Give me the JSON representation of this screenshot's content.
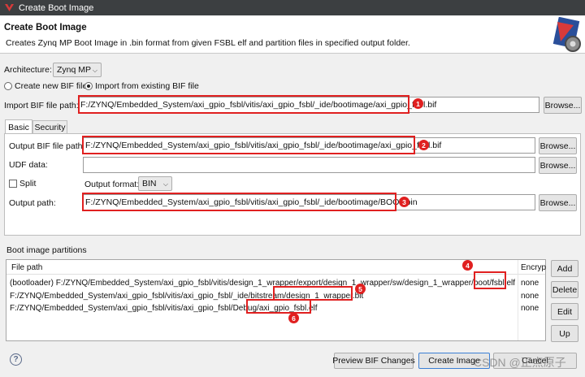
{
  "window": {
    "title": "Create Boot Image"
  },
  "header": {
    "title": "Create Boot Image",
    "description": "Creates Zynq MP Boot Image in .bin format from given FSBL elf and partition files in specified output folder."
  },
  "architecture": {
    "label": "Architecture:",
    "value": "Zynq MP"
  },
  "mode": {
    "create_new": "Create new BIF file",
    "import_existing": "Import from existing BIF file",
    "selected": "import_existing"
  },
  "import_bif": {
    "label": "Import BIF file path:",
    "value": "F:/ZYNQ/Embedded_System/axi_gpio_fsbl/vitis/axi_gpio_fsbl/_ide/bootimage/axi_gpio_fsbl.bif",
    "browse": "Browse...",
    "marker": "1"
  },
  "tabs": [
    {
      "label": "Basic"
    },
    {
      "label": "Security"
    }
  ],
  "output_bif": {
    "label": "Output BIF file path:",
    "value": "F:/ZYNQ/Embedded_System/axi_gpio_fsbl/vitis/axi_gpio_fsbl/_ide/bootimage/axi_gpio_fsbl.bif",
    "browse": "Browse...",
    "marker": "2"
  },
  "udf": {
    "label": "UDF data:",
    "value": "",
    "browse": "Browse..."
  },
  "split": {
    "label": "Split",
    "checked": false
  },
  "output_format": {
    "label": "Output format:",
    "value": "BIN"
  },
  "output_path": {
    "label": "Output path:",
    "value": "F:/ZYNQ/Embedded_System/axi_gpio_fsbl/vitis/axi_gpio_fsbl/_ide/bootimage/BOOT.bin",
    "browse": "Browse...",
    "marker": "3"
  },
  "partitions": {
    "section_label": "Boot image partitions",
    "columns": [
      "File path",
      "Encryp"
    ],
    "rows": [
      {
        "path": "(bootloader) F:/ZYNQ/Embedded_System/axi_gpio_fsbl/vitis/design_1_wrapper/export/design_1_wrapper/sw/design_1_wrapper/boot/fsbl.elf",
        "enc": "none"
      },
      {
        "path": "F:/ZYNQ/Embedded_System/axi_gpio_fsbl/vitis/axi_gpio_fsbl/_ide/bitstream/design_1_wrapper.bit",
        "enc": "none"
      },
      {
        "path": "F:/ZYNQ/Embedded_System/axi_gpio_fsbl/vitis/axi_gpio_fsbl/Debug/axi_gpio_fsbl.elf",
        "enc": "none"
      }
    ],
    "markers": [
      "4",
      "5",
      "6"
    ],
    "buttons": {
      "add": "Add",
      "delete": "Delete",
      "edit": "Edit",
      "up": "Up"
    }
  },
  "footer": {
    "preview": "Preview BIF Changes",
    "create": "Create Image",
    "cancel": "Cancel",
    "help": "?"
  },
  "watermark": "CSDN @正点原子",
  "colors": {
    "titlebar": "#3c3f41",
    "highlight": "#e02020",
    "background": "#f0f0f0"
  }
}
